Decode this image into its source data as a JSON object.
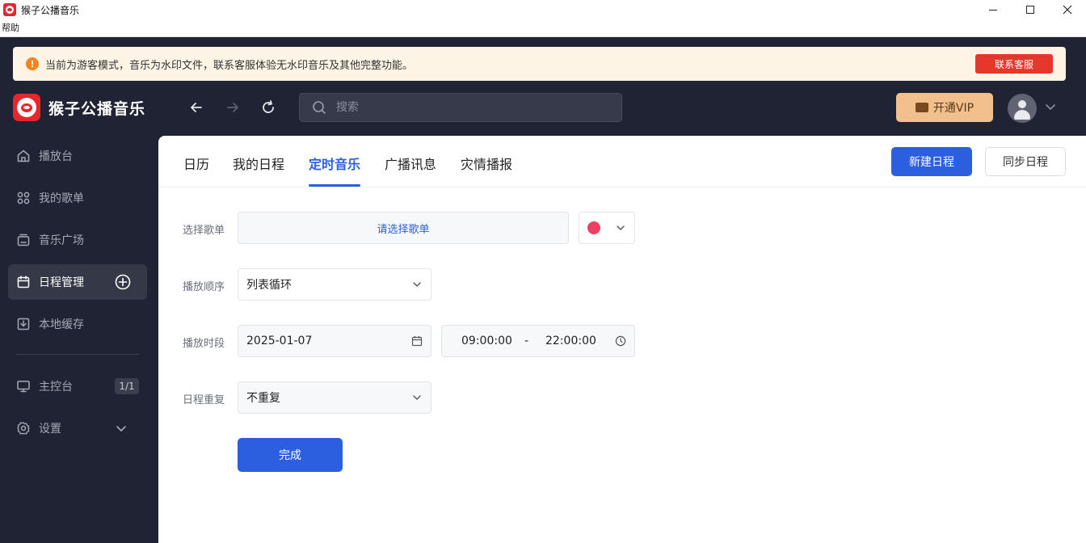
{
  "window": {
    "title": "猴子公播音乐",
    "menu": [
      "帮助"
    ]
  },
  "notice": {
    "text": "当前为游客模式，音乐为水印文件，联系客服体验无水印音乐及其他完整功能。",
    "contact_label": "联系客服",
    "icon": "warning-icon"
  },
  "header": {
    "brand": "猴子公播音乐",
    "search_placeholder": "搜索",
    "vip_label": "开通VIP"
  },
  "sidebar": {
    "items": [
      {
        "label": "播放台",
        "icon": "home-icon"
      },
      {
        "label": "我的歌单",
        "icon": "playlist-icon"
      },
      {
        "label": "音乐广场",
        "icon": "music-square-icon"
      },
      {
        "label": "日程管理",
        "icon": "calendar-icon",
        "active": true
      },
      {
        "label": "本地缓存",
        "icon": "download-icon"
      }
    ],
    "console": {
      "label": "主控台",
      "badge": "1/1",
      "icon": "monitor-icon"
    },
    "settings": {
      "label": "设置",
      "icon": "gear-icon"
    }
  },
  "tabs": {
    "items": [
      "日历",
      "我的日程",
      "定时音乐",
      "广播讯息",
      "灾情播报"
    ],
    "active_index": 2,
    "new_label": "新建日程",
    "sync_label": "同步日程"
  },
  "form": {
    "playlist_label": "选择歌单",
    "playlist_value": "请选择歌单",
    "color": "#f0405f",
    "order_label": "播放顺序",
    "order_value": "列表循环",
    "time_label": "播放时段",
    "date_value": "2025-01-07",
    "start_time": "09:00:00",
    "separator": "-",
    "end_time": "22:00:00",
    "repeat_label": "日程重复",
    "repeat_value": "不重复",
    "done_label": "完成"
  },
  "colors": {
    "accent": "#2b5fe0",
    "sidebar_bg": "#1f2333",
    "notice_bg": "#fdf4e6",
    "danger": "#e5372b",
    "vip": "#f2c08c"
  }
}
